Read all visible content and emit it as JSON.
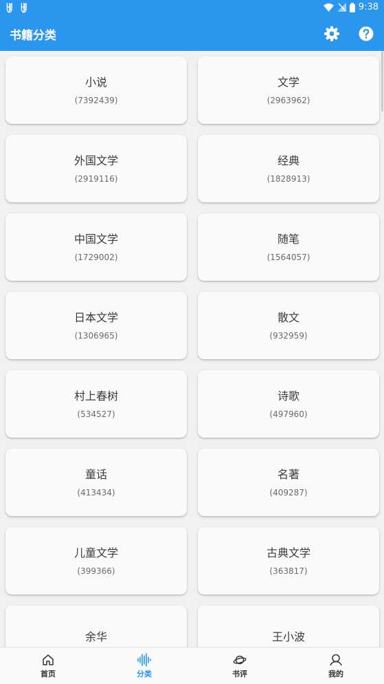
{
  "status_bar": {
    "left_glyphs": "ꂍ ꂍ",
    "time": "9:38"
  },
  "app_bar": {
    "title": "书籍分类",
    "settings_icon": "gear-icon",
    "help_icon": "question-circle-icon"
  },
  "accent_color": "#2b96ee",
  "categories": [
    {
      "name": "小说",
      "count": "(7392439)"
    },
    {
      "name": "文学",
      "count": "(2963962)"
    },
    {
      "name": "外国文学",
      "count": "(2919116)"
    },
    {
      "name": "经典",
      "count": "(1828913)"
    },
    {
      "name": "中国文学",
      "count": "(1729002)"
    },
    {
      "name": "随笔",
      "count": "(1564057)"
    },
    {
      "name": "日本文学",
      "count": "(1306965)"
    },
    {
      "name": "散文",
      "count": "(932959)"
    },
    {
      "name": "村上春树",
      "count": "(534527)"
    },
    {
      "name": "诗歌",
      "count": "(497960)"
    },
    {
      "name": "童话",
      "count": "(413434)"
    },
    {
      "name": "名著",
      "count": "(409287)"
    },
    {
      "name": "儿童文学",
      "count": "(399366)"
    },
    {
      "name": "古典文学",
      "count": "(363817)"
    },
    {
      "name": "余华",
      "count": ""
    },
    {
      "name": "王小波",
      "count": ""
    }
  ],
  "bottom_nav": [
    {
      "label": "首页",
      "icon": "home-icon",
      "active": false
    },
    {
      "label": "分类",
      "icon": "soundwave-icon",
      "active": true
    },
    {
      "label": "书评",
      "icon": "planet-icon",
      "active": false
    },
    {
      "label": "我的",
      "icon": "person-icon",
      "active": false
    }
  ]
}
